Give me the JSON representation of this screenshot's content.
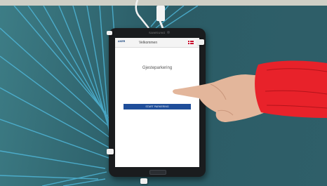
{
  "tablet": {
    "brand": "SAMSUNG",
    "logo_text": "AKER",
    "header_title": "Velkommen",
    "page_heading": "Gjesteparkering",
    "button_label": "START PARKERING"
  },
  "colors": {
    "wall": "#2f5f69",
    "wall_lines": "#4fb6d8",
    "button": "#1f4e9a",
    "sleeve": "#e8222a"
  },
  "icons": {
    "language_flag": "norway-flag-icon"
  }
}
